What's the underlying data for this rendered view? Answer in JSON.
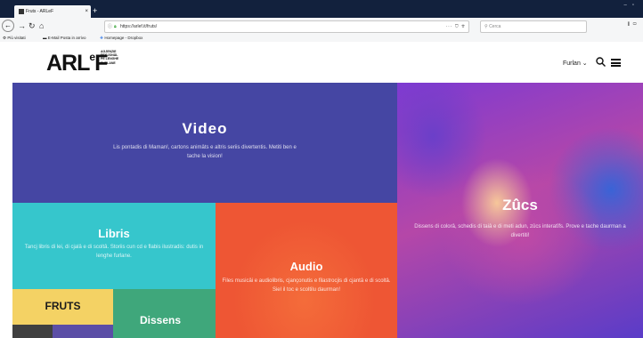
{
  "browser": {
    "tab_title": "Fruts - ARLeF",
    "tab_close": "×",
    "new_tab": "+",
    "url": "https://arlef.it/fruts/",
    "url_actions": "··· ⛉ ☆",
    "search_placeholder": "Cerca",
    "bookmarks": [
      {
        "icon": "⚙",
        "label": "Più visitati"
      },
      {
        "icon": "▬",
        "label": "E-Mail Posta in arrivo"
      },
      {
        "icon": "❖",
        "label": "Homepage - Dropbox"
      }
    ]
  },
  "site": {
    "logo_text": "ARL",
    "logo_e": "e",
    "logo_f": "F",
    "logo_sub": [
      "AGJENZIE",
      "REGJONÂL",
      "PE LENGHE",
      "FURLANE"
    ],
    "language": "Furlan",
    "language_caret": "⌄"
  },
  "tiles": {
    "video": {
      "title": "Video",
      "text": "Lis pontadis di Maman!, cartons animâts e altris seriis divertentis. Metiti ben e tache la vision!"
    },
    "zucs": {
      "title": "Zûcs",
      "text": "Dissens di colorâ, schedis di taiâ e di meti adun, zûcs interatîfs. Prove e tache daurman a divertiti!"
    },
    "libris": {
      "title": "Libris",
      "text": "Tancj libris di lei, di cjalâ e di scoltâ. Storiis cun cd e flabis ilustradis: dutis in lenghe furlane."
    },
    "audio": {
      "title": "Audio",
      "text": "Files musicâi e audiolibris, cjançonutis e filastrocjis di cjantâ e di scoltâ. Siel il toc e scoltilu daurman!"
    },
    "fruts": {
      "title": "FRUTS"
    },
    "dissens": {
      "title": "Dissens"
    }
  },
  "colors": {
    "video": "#4546a3",
    "libris": "#36c6cc",
    "audio": "#ee5634",
    "fruts": "#f4d264",
    "dissens": "#3fa77b"
  }
}
